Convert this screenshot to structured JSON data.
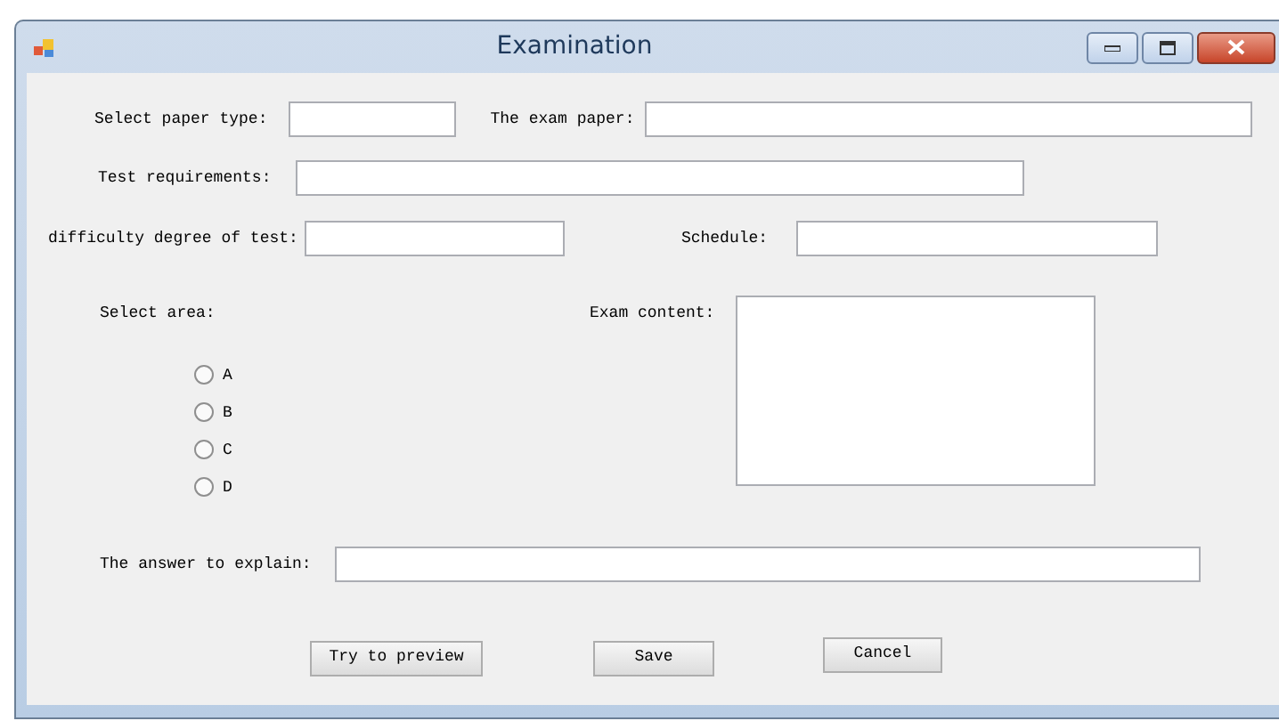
{
  "window": {
    "title": "Examination"
  },
  "paper_type": {
    "label": "Select paper type:"
  },
  "exam_paper": {
    "label": "The exam paper:"
  },
  "test_requirements": {
    "label": "Test requirements:"
  },
  "difficulty": {
    "label": "difficulty degree of test:"
  },
  "schedule": {
    "label": "Schedule:"
  },
  "select_area": {
    "label": "Select area:",
    "options": [
      {
        "label": "A",
        "selected": false
      },
      {
        "label": "B",
        "selected": false
      },
      {
        "label": "C",
        "selected": false
      },
      {
        "label": "D",
        "selected": false
      }
    ]
  },
  "exam_content": {
    "label": "Exam content:"
  },
  "answer_explain": {
    "label": "The answer to explain:"
  },
  "buttons": [
    "Try to preview",
    "Save",
    "Cancel"
  ]
}
